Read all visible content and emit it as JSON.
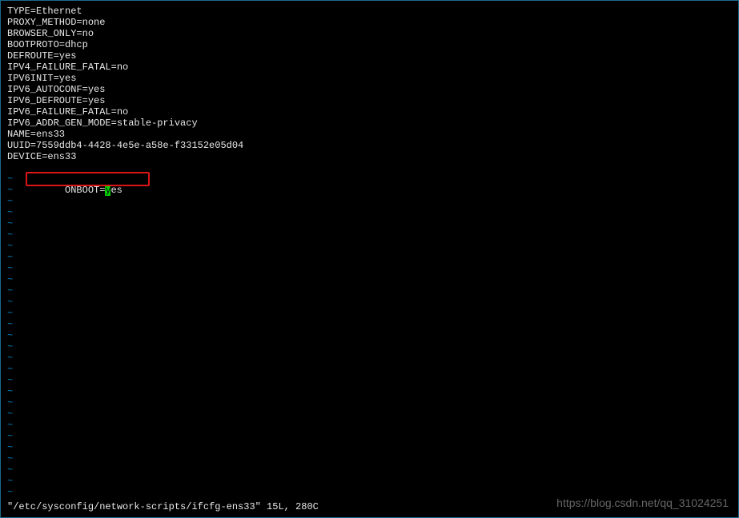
{
  "config": {
    "lines": [
      "TYPE=Ethernet",
      "PROXY_METHOD=none",
      "BROWSER_ONLY=no",
      "BOOTPROTO=dhcp",
      "DEFROUTE=yes",
      "IPV4_FAILURE_FATAL=no",
      "IPV6INIT=yes",
      "IPV6_AUTOCONF=yes",
      "IPV6_DEFROUTE=yes",
      "IPV6_FAILURE_FATAL=no",
      "IPV6_ADDR_GEN_MODE=stable-privacy",
      "NAME=ens33",
      "UUID=7559ddb4-4428-4e5e-a58e-f33152e05d04",
      "DEVICE=ens33"
    ],
    "highlighted": {
      "prefix": "ONBOOT=",
      "cursor_char": "y",
      "suffix": "es"
    }
  },
  "tilde_char": "~",
  "status": "\"/etc/sysconfig/network-scripts/ifcfg-ens33\" 15L, 280C",
  "watermark": "https://blog.csdn.net/qq_31024251"
}
